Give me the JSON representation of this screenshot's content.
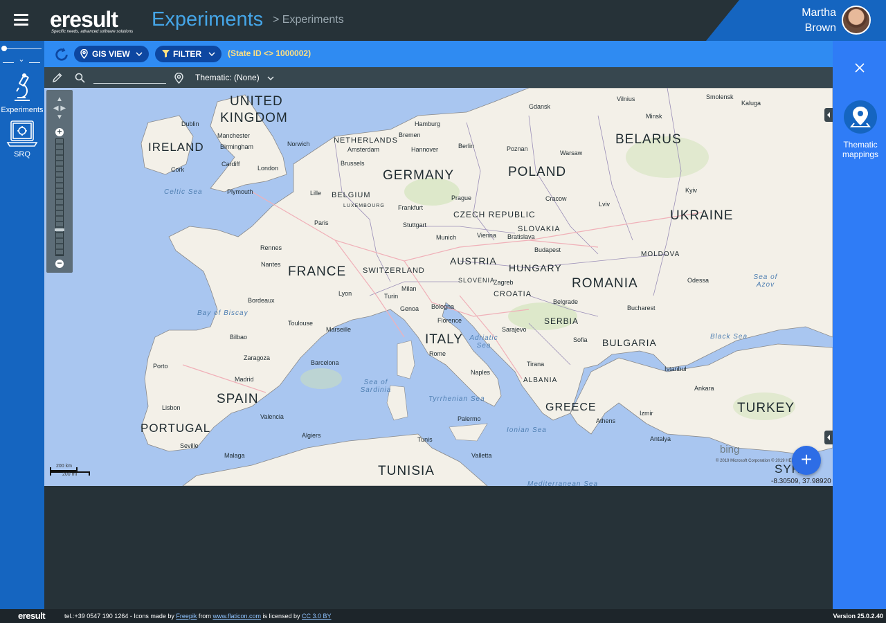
{
  "header": {
    "logo_text": "eresult",
    "logo_tagline": "Specific needs, advanced software solutions",
    "title": "Experiments",
    "breadcrumb": "> Experiments",
    "user_first": "Martha",
    "user_last": "Brown"
  },
  "left_nav": {
    "items": [
      {
        "label": "Experiments",
        "icon": "microscope-icon"
      },
      {
        "label": "SRQ",
        "icon": "laptop-icon"
      }
    ]
  },
  "toolbar": {
    "gis_label": "GIS VIEW",
    "filter_label": "FILTER",
    "state_filter": "(State ID <> 1000002)"
  },
  "map_toolbar": {
    "search_value": "",
    "thematic_label": "Thematic: (None)"
  },
  "map": {
    "countries": [
      "UNITED",
      "KINGDOM",
      "IRELAND",
      "GERMANY",
      "POLAND",
      "BELARUS",
      "UKRAINE",
      "FRANCE",
      "AUSTRIA",
      "HUNGARY",
      "ROMANIA",
      "ITALY",
      "SPAIN",
      "PORTUGAL",
      "GREECE",
      "TURKEY",
      "TUNISIA",
      "BULGARIA",
      "SERBIA",
      "CROATIA",
      "SLOVAKIA",
      "CZECH REPUBLIC",
      "BELGIUM",
      "NETHERLANDS",
      "SWITZERLAND",
      "SLOVENIA",
      "ALBANIA",
      "MOLDOVA",
      "LUXEMBOURG",
      "SYR"
    ],
    "cities": [
      "Dublin",
      "Cork",
      "Manchester",
      "Birmingham",
      "Cardiff",
      "London",
      "Plymouth",
      "Norwich",
      "Amsterdam",
      "Brussels",
      "Lille",
      "Paris",
      "Rennes",
      "Nantes",
      "Bordeaux",
      "Toulouse",
      "Marseille",
      "Lyon",
      "Hamburg",
      "Bremen",
      "Hannover",
      "Berlin",
      "Frankfurt",
      "Stuttgart",
      "Munich",
      "Prague",
      "Vienna",
      "Bratislava",
      "Budapest",
      "Warsaw",
      "Poznan",
      "Gdansk",
      "Cracow",
      "Lviv",
      "Kyiv",
      "Minsk",
      "Vilnius",
      "Smolensk",
      "Kaluga",
      "Zagreb",
      "Belgrade",
      "Sarajevo",
      "Sofia",
      "Bucharest",
      "Odessa",
      "Milan",
      "Turin",
      "Genoa",
      "Bologna",
      "Florence",
      "Rome",
      "Naples",
      "Palermo",
      "Tirana",
      "Athens",
      "Istanbul",
      "Ankara",
      "Madrid",
      "Barcelona",
      "Valencia",
      "Lisbon",
      "Porto",
      "Seville",
      "Malaga",
      "Algiers",
      "Tunis",
      "Valletta",
      "Izmir",
      "Antalya",
      "Zaragoza",
      "Bilbao"
    ],
    "seas": [
      "Celtic Sea",
      "Bay of Biscay",
      "Sea of Sardinia",
      "Tyrrhenian Sea",
      "Adriatic Sea",
      "Ionian Sea",
      "Mediterranean Sea",
      "Black Sea",
      "Sea of Azov"
    ],
    "scale_km": "200 km",
    "scale_mi": "200 mi",
    "brand": "bing",
    "copyright": "© 2019 Microsoft Corporation © 2019 HERE",
    "coordinates": "-8.30509, 37.98920"
  },
  "right_panel": {
    "thematic_label": "Thematic mappings"
  },
  "footer": {
    "logo": "eresult",
    "tel": "tel.:+39 0547 190 1264 - Icons made by",
    "link_freepik": "Freepik",
    "from": "from",
    "link_flaticon": "www.flaticon.com",
    "licensed": "is licensed by",
    "link_cc": "CC 3.0 BY",
    "version": "Version 25.0.2.40"
  },
  "colors": {
    "brand_blue": "#1565c0",
    "toolbar_blue": "#2f8bf2",
    "panel_blue": "#2f7cf6",
    "title_blue": "#45a6e8",
    "state_yellow": "#ffe082",
    "dark_bg": "#263238"
  }
}
